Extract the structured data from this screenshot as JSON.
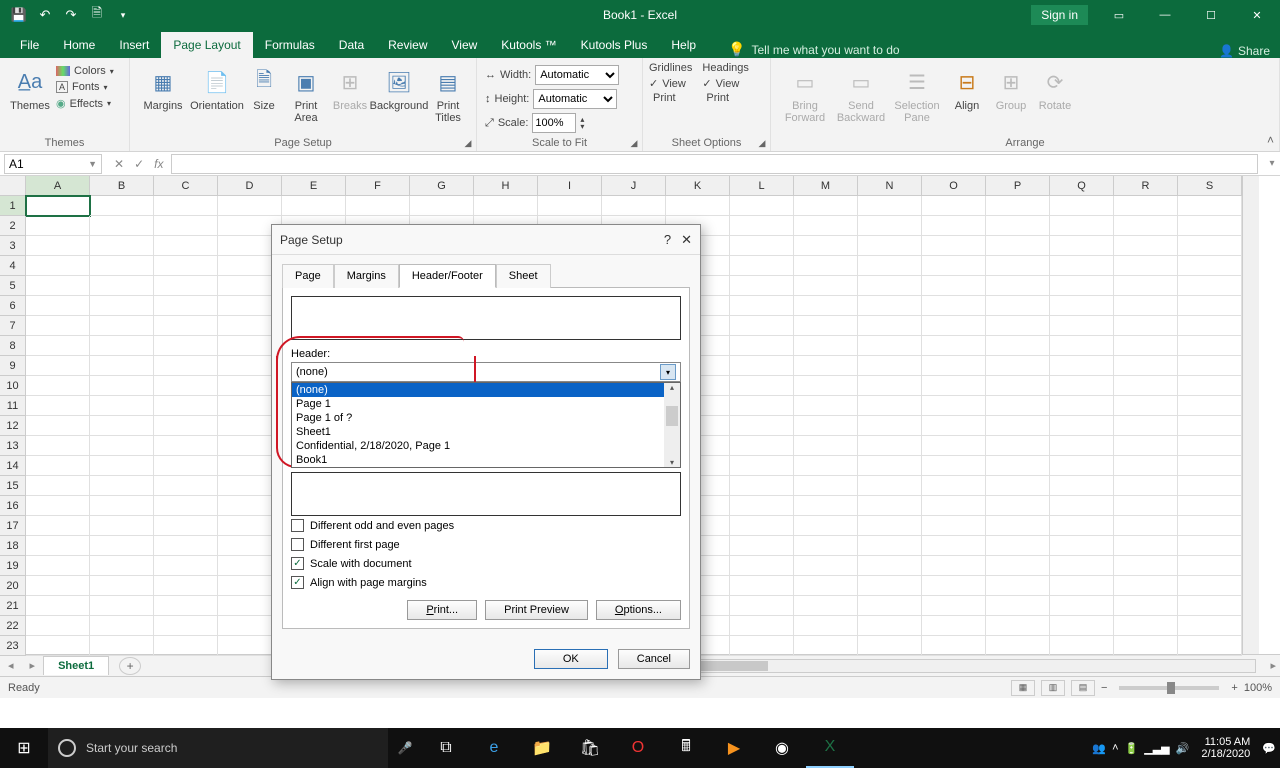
{
  "titlebar": {
    "app_title": "Book1  -  Excel",
    "signin": "Sign in"
  },
  "tabs": {
    "file": "File",
    "home": "Home",
    "insert": "Insert",
    "page_layout": "Page Layout",
    "formulas": "Formulas",
    "data": "Data",
    "review": "Review",
    "view": "View",
    "kutools": "Kutools ™",
    "kutools_plus": "Kutools Plus",
    "help": "Help",
    "tellme": "Tell me what you want to do",
    "share": "Share"
  },
  "ribbon": {
    "themes": {
      "label": "Themes",
      "themes": "Themes",
      "colors": "Colors",
      "fonts": "Fonts",
      "effects": "Effects"
    },
    "page_setup": {
      "label": "Page Setup",
      "margins": "Margins",
      "orientation": "Orientation",
      "size": "Size",
      "print_area": "Print\nArea",
      "breaks": "Breaks",
      "background": "Background",
      "print_titles": "Print\nTitles"
    },
    "scale": {
      "label": "Scale to Fit",
      "width": "Width:",
      "height": "Height:",
      "scale": "Scale:",
      "auto": "Automatic",
      "pct": "100%"
    },
    "sheet_options": {
      "label": "Sheet Options",
      "gridlines": "Gridlines",
      "headings": "Headings",
      "view": "View",
      "print": "Print"
    },
    "arrange": {
      "label": "Arrange",
      "bring": "Bring\nForward",
      "send": "Send\nBackward",
      "selpane": "Selection\nPane",
      "align": "Align",
      "group": "Group",
      "rotate": "Rotate"
    }
  },
  "namebox": "A1",
  "columns": [
    "A",
    "B",
    "C",
    "D",
    "E",
    "F",
    "G",
    "H",
    "I",
    "J",
    "K",
    "L",
    "M",
    "N",
    "O",
    "P",
    "Q",
    "R",
    "S"
  ],
  "rows": [
    "1",
    "2",
    "3",
    "4",
    "5",
    "6",
    "7",
    "8",
    "9",
    "10",
    "11",
    "12",
    "13",
    "14",
    "15",
    "16",
    "17",
    "18",
    "19",
    "20",
    "21",
    "22",
    "23"
  ],
  "sheet_tab": "Sheet1",
  "status_ready": "Ready",
  "zoom_pct": "100%",
  "dialog": {
    "title": "Page Setup",
    "tabs": {
      "page": "Page",
      "margins": "Margins",
      "hf": "Header/Footer",
      "sheet": "Sheet"
    },
    "header_label": "Header:",
    "header_value": "(none)",
    "options": [
      "(none)",
      "Page 1",
      "Page 1 of ?",
      "Sheet1",
      "  Confidential, 2/18/2020, Page 1",
      "Book1"
    ],
    "chk": {
      "odd": "Different odd and even pages",
      "first": "Different first page",
      "scale": "Scale with document",
      "align": "Align with page margins"
    },
    "btn": {
      "print": "Print...",
      "preview": "Print Preview",
      "options": "Options...",
      "ok": "OK",
      "cancel": "Cancel"
    }
  },
  "taskbar": {
    "search_placeholder": "Start your search",
    "time": "11:05 AM",
    "date": "2/18/2020"
  }
}
